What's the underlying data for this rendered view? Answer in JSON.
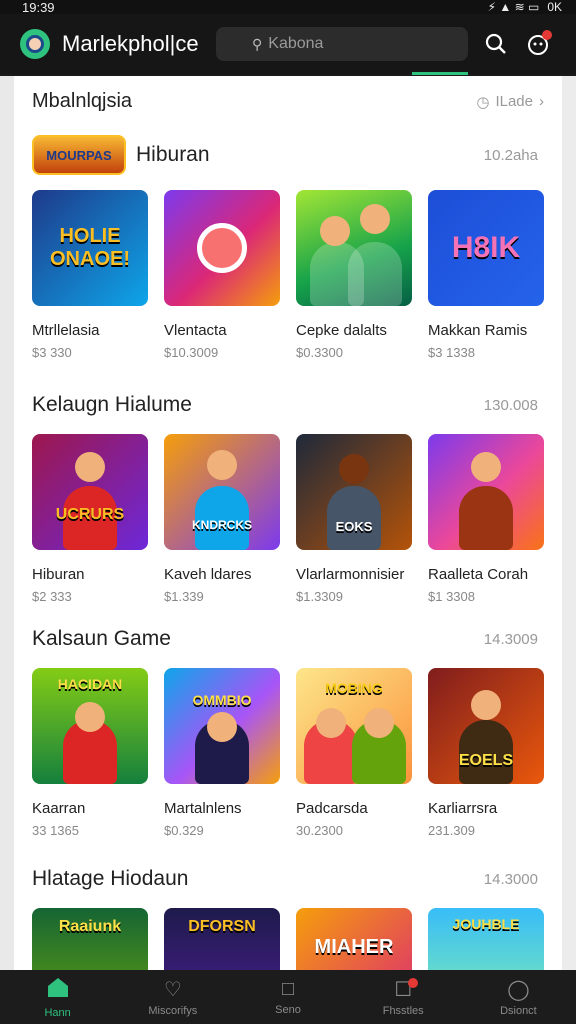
{
  "status": {
    "time": "19:39",
    "icons": "⚡ ▲ ≋ ▭",
    "battery": "0K"
  },
  "header": {
    "title": "Marlekphol|ce",
    "search_placeholder": "Kabona",
    "search_icon": "search-icon",
    "actions": [
      "search-icon",
      "notification-icon"
    ]
  },
  "top": {
    "title": "Mbalnlqjsia",
    "more_label": "ILade"
  },
  "sections": [
    {
      "title": "Hiburan",
      "count": "10.2aha",
      "badge_text": "MOURPAS",
      "items": [
        {
          "name": "Mtrllelasia",
          "price": "$3 330",
          "thumb_text": "HOLIE ONAOE!"
        },
        {
          "name": "Vlentacta",
          "price": "$10.3009",
          "thumb_text": ""
        },
        {
          "name": "Cepke dalalts",
          "price": "$0.3300",
          "thumb_text": ""
        },
        {
          "name": "Makkan Ramis",
          "price": "$3 1338",
          "thumb_text": "H8IK"
        }
      ]
    },
    {
      "title": "Kelaugn Hialume",
      "count": "130.008",
      "items": [
        {
          "name": "Hiburan",
          "price": "$2 333",
          "thumb_text": "UCRURS"
        },
        {
          "name": "Kaveh ldares",
          "price": "$1.339",
          "thumb_text": "KNDRCKS"
        },
        {
          "name": "Vlarlarmonnisier",
          "price": "$1.3309",
          "thumb_text": "EOKS"
        },
        {
          "name": "Raalleta Corah",
          "price": "$1 3308",
          "thumb_text": ""
        }
      ]
    },
    {
      "title": "Kalsaun Game",
      "count": "14.3009",
      "items": [
        {
          "name": "Kaarran",
          "price": "33 1365",
          "thumb_text": "HACIDAN"
        },
        {
          "name": "Martalnlens",
          "price": "$0.329",
          "thumb_text": "OMMBIO"
        },
        {
          "name": "Padcarsda",
          "price": "30.2300",
          "thumb_text": "MOBING"
        },
        {
          "name": "Karliarrsra",
          "price": "231.309",
          "thumb_text": "EOELS"
        }
      ]
    },
    {
      "title": "Hlatage Hiodaun",
      "count": "14.3000",
      "items": [
        {
          "name": "",
          "price": "",
          "thumb_text": "Raaiunk"
        },
        {
          "name": "",
          "price": "",
          "thumb_text": "DFORSN"
        },
        {
          "name": "",
          "price": "",
          "thumb_text": "MIAHER"
        },
        {
          "name": "",
          "price": "",
          "thumb_text": "JOUHBLE"
        }
      ]
    }
  ],
  "nav": [
    {
      "label": "Hann",
      "icon": "home-icon",
      "active": true
    },
    {
      "label": "Miscorifys",
      "icon": "heart-icon",
      "active": false
    },
    {
      "label": "Seno",
      "icon": "edit-icon",
      "active": false
    },
    {
      "label": "Fhsstles",
      "icon": "chat-icon",
      "active": false,
      "badge": true
    },
    {
      "label": "Dsionct",
      "icon": "profile-icon",
      "active": false
    }
  ],
  "colors": {
    "accent": "#2ec27e",
    "header_bg": "#161616",
    "badge": "#e53935"
  }
}
